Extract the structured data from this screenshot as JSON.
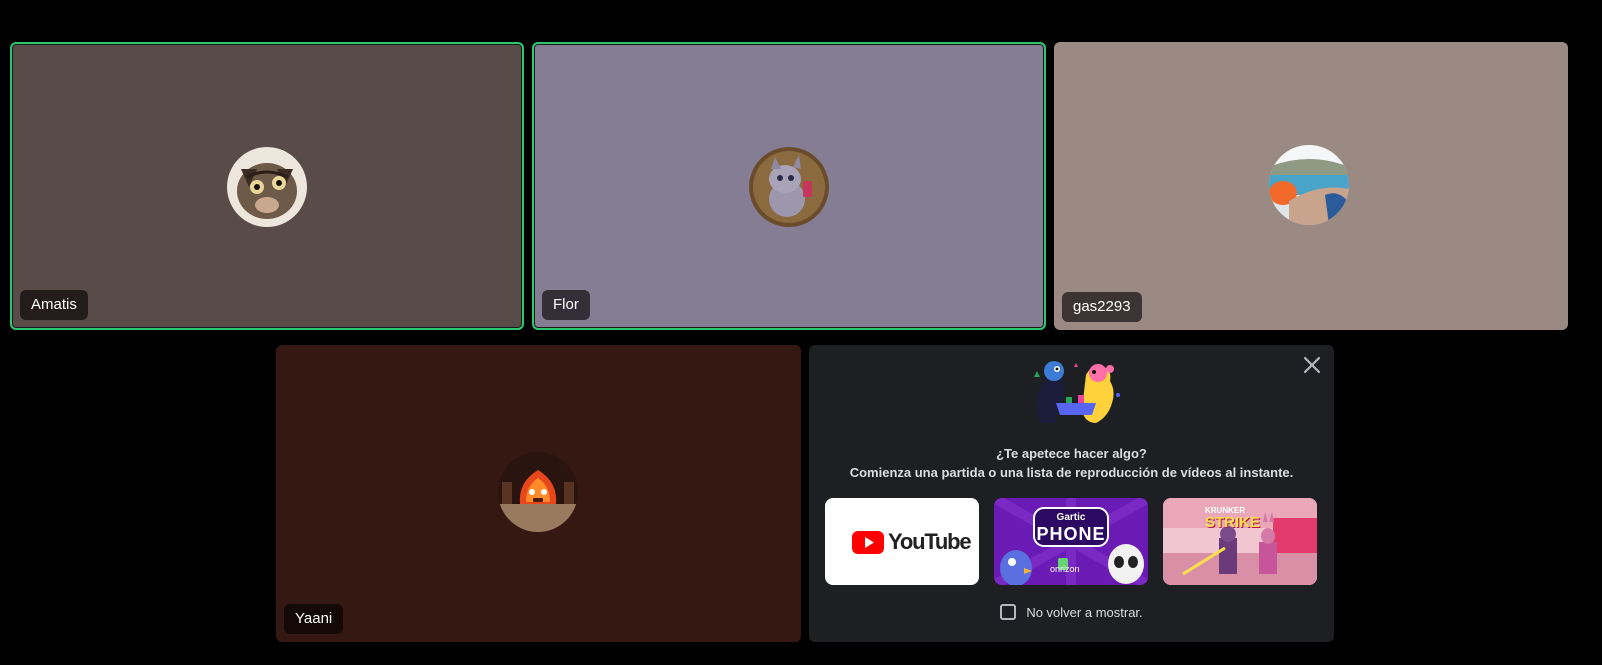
{
  "participants": [
    {
      "name": "Amatis",
      "avatar": "cat-avatar",
      "speaking": true,
      "bg": "#594b47"
    },
    {
      "name": "Flor",
      "avatar": "wolf-avatar",
      "speaking": true,
      "bg": "#847d94"
    },
    {
      "name": "gas2293",
      "avatar": "poolside-photo-avatar",
      "speaking": false,
      "bg": "#9b8983"
    },
    {
      "name": "Yaani",
      "avatar": "fire-avatar",
      "speaking": false,
      "bg": "#351812"
    }
  ],
  "activity_panel": {
    "title": "¿Te apetece hacer algo?",
    "subtitle": "Comienza una partida o una lista de reproducción de vídeos al instante.",
    "activities": [
      {
        "name": "YouTube",
        "icon": "youtube-logo"
      },
      {
        "name": "Gartic Phone",
        "logo_text_top": "Gartic",
        "logo_text_main": "PHONE",
        "publisher": "onrizon"
      },
      {
        "name": "Krunker Strike",
        "logo_text_top": "KRUNKER",
        "logo_text_main": "STRIKE"
      }
    ],
    "dont_show_again": "No volver a mostrar.",
    "close_icon": "close-icon"
  },
  "colors": {
    "speaking_ring": "#2dc770",
    "panel_bg": "#1e1f22",
    "youtube_red": "#ff0000"
  }
}
